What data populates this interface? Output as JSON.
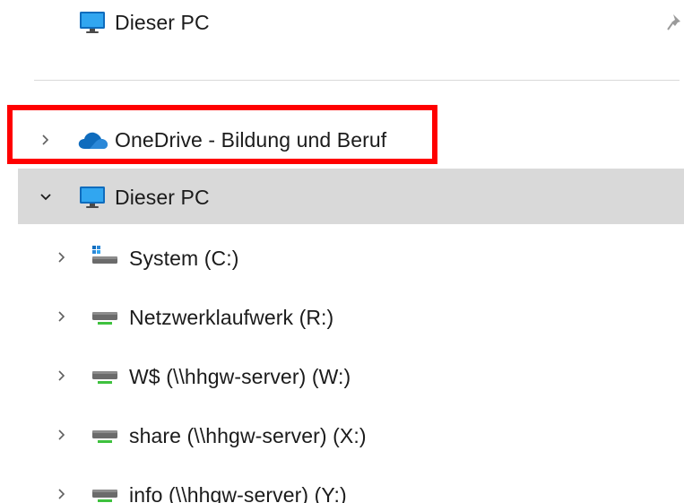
{
  "quick_access": {
    "pinned_item_label": "Dieser PC"
  },
  "tree": {
    "onedrive_label": "OneDrive - Bildung und Beruf",
    "this_pc_label": "Dieser PC",
    "drives": [
      {
        "label": "System (C:)"
      },
      {
        "label": "Netzwerklaufwerk (R:)"
      },
      {
        "label": "W$ (\\\\hhgw-server) (W:)"
      },
      {
        "label": "share (\\\\hhgw-server) (X:)"
      },
      {
        "label": "info (\\\\hhgw-server) (Y:)"
      }
    ]
  },
  "colors": {
    "selection": "#d9d9d9",
    "annotation": "#ff0000",
    "onedrive": "#0f6cbd",
    "drive_led": "#3ec13e"
  }
}
